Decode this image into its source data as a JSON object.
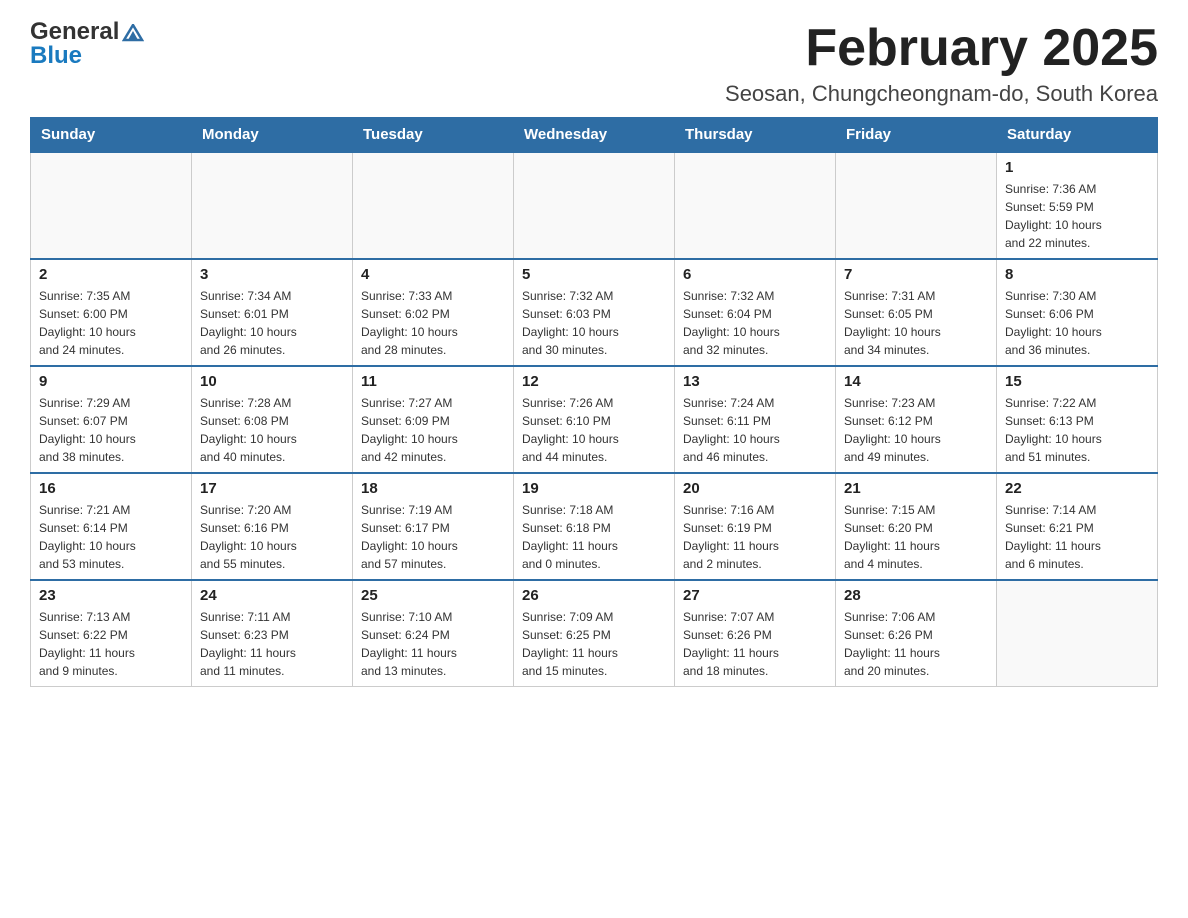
{
  "header": {
    "logo_general": "General",
    "logo_blue": "Blue",
    "month_title": "February 2025",
    "location": "Seosan, Chungcheongnam-do, South Korea"
  },
  "days_of_week": [
    "Sunday",
    "Monday",
    "Tuesday",
    "Wednesday",
    "Thursday",
    "Friday",
    "Saturday"
  ],
  "weeks": [
    {
      "days": [
        {
          "number": "",
          "info": ""
        },
        {
          "number": "",
          "info": ""
        },
        {
          "number": "",
          "info": ""
        },
        {
          "number": "",
          "info": ""
        },
        {
          "number": "",
          "info": ""
        },
        {
          "number": "",
          "info": ""
        },
        {
          "number": "1",
          "info": "Sunrise: 7:36 AM\nSunset: 5:59 PM\nDaylight: 10 hours\nand 22 minutes."
        }
      ]
    },
    {
      "days": [
        {
          "number": "2",
          "info": "Sunrise: 7:35 AM\nSunset: 6:00 PM\nDaylight: 10 hours\nand 24 minutes."
        },
        {
          "number": "3",
          "info": "Sunrise: 7:34 AM\nSunset: 6:01 PM\nDaylight: 10 hours\nand 26 minutes."
        },
        {
          "number": "4",
          "info": "Sunrise: 7:33 AM\nSunset: 6:02 PM\nDaylight: 10 hours\nand 28 minutes."
        },
        {
          "number": "5",
          "info": "Sunrise: 7:32 AM\nSunset: 6:03 PM\nDaylight: 10 hours\nand 30 minutes."
        },
        {
          "number": "6",
          "info": "Sunrise: 7:32 AM\nSunset: 6:04 PM\nDaylight: 10 hours\nand 32 minutes."
        },
        {
          "number": "7",
          "info": "Sunrise: 7:31 AM\nSunset: 6:05 PM\nDaylight: 10 hours\nand 34 minutes."
        },
        {
          "number": "8",
          "info": "Sunrise: 7:30 AM\nSunset: 6:06 PM\nDaylight: 10 hours\nand 36 minutes."
        }
      ]
    },
    {
      "days": [
        {
          "number": "9",
          "info": "Sunrise: 7:29 AM\nSunset: 6:07 PM\nDaylight: 10 hours\nand 38 minutes."
        },
        {
          "number": "10",
          "info": "Sunrise: 7:28 AM\nSunset: 6:08 PM\nDaylight: 10 hours\nand 40 minutes."
        },
        {
          "number": "11",
          "info": "Sunrise: 7:27 AM\nSunset: 6:09 PM\nDaylight: 10 hours\nand 42 minutes."
        },
        {
          "number": "12",
          "info": "Sunrise: 7:26 AM\nSunset: 6:10 PM\nDaylight: 10 hours\nand 44 minutes."
        },
        {
          "number": "13",
          "info": "Sunrise: 7:24 AM\nSunset: 6:11 PM\nDaylight: 10 hours\nand 46 minutes."
        },
        {
          "number": "14",
          "info": "Sunrise: 7:23 AM\nSunset: 6:12 PM\nDaylight: 10 hours\nand 49 minutes."
        },
        {
          "number": "15",
          "info": "Sunrise: 7:22 AM\nSunset: 6:13 PM\nDaylight: 10 hours\nand 51 minutes."
        }
      ]
    },
    {
      "days": [
        {
          "number": "16",
          "info": "Sunrise: 7:21 AM\nSunset: 6:14 PM\nDaylight: 10 hours\nand 53 minutes."
        },
        {
          "number": "17",
          "info": "Sunrise: 7:20 AM\nSunset: 6:16 PM\nDaylight: 10 hours\nand 55 minutes."
        },
        {
          "number": "18",
          "info": "Sunrise: 7:19 AM\nSunset: 6:17 PM\nDaylight: 10 hours\nand 57 minutes."
        },
        {
          "number": "19",
          "info": "Sunrise: 7:18 AM\nSunset: 6:18 PM\nDaylight: 11 hours\nand 0 minutes."
        },
        {
          "number": "20",
          "info": "Sunrise: 7:16 AM\nSunset: 6:19 PM\nDaylight: 11 hours\nand 2 minutes."
        },
        {
          "number": "21",
          "info": "Sunrise: 7:15 AM\nSunset: 6:20 PM\nDaylight: 11 hours\nand 4 minutes."
        },
        {
          "number": "22",
          "info": "Sunrise: 7:14 AM\nSunset: 6:21 PM\nDaylight: 11 hours\nand 6 minutes."
        }
      ]
    },
    {
      "days": [
        {
          "number": "23",
          "info": "Sunrise: 7:13 AM\nSunset: 6:22 PM\nDaylight: 11 hours\nand 9 minutes."
        },
        {
          "number": "24",
          "info": "Sunrise: 7:11 AM\nSunset: 6:23 PM\nDaylight: 11 hours\nand 11 minutes."
        },
        {
          "number": "25",
          "info": "Sunrise: 7:10 AM\nSunset: 6:24 PM\nDaylight: 11 hours\nand 13 minutes."
        },
        {
          "number": "26",
          "info": "Sunrise: 7:09 AM\nSunset: 6:25 PM\nDaylight: 11 hours\nand 15 minutes."
        },
        {
          "number": "27",
          "info": "Sunrise: 7:07 AM\nSunset: 6:26 PM\nDaylight: 11 hours\nand 18 minutes."
        },
        {
          "number": "28",
          "info": "Sunrise: 7:06 AM\nSunset: 6:26 PM\nDaylight: 11 hours\nand 20 minutes."
        },
        {
          "number": "",
          "info": ""
        }
      ]
    }
  ]
}
